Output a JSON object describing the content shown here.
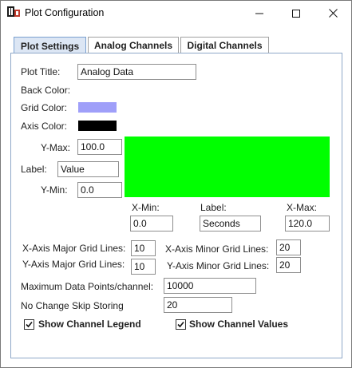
{
  "window": {
    "title": "Plot Configuration",
    "icons": {
      "app": "app-logo-icon",
      "minimize": "minimize-icon",
      "maximize": "maximize-icon",
      "close": "close-icon"
    }
  },
  "tabs": [
    {
      "label": "Plot Settings",
      "active": true
    },
    {
      "label": "Analog Channels",
      "active": false
    },
    {
      "label": "Digital Channels",
      "active": false
    }
  ],
  "plot_settings": {
    "plot_title_label": "Plot Title:",
    "plot_title_value": "Analog Data",
    "back_color_label": "Back Color:",
    "back_color": "#ffffff",
    "grid_color_label": "Grid Color:",
    "grid_color": "#9f9ff9",
    "axis_color_label": "Axis Color:",
    "axis_color": "#000000",
    "plot_preview_color": "#00ff00",
    "ymax_label": "Y-Max:",
    "ymax_value": "100.0",
    "ylabel_label": "Label:",
    "ylabel_value": "Value",
    "ymin_label": "Y-Min:",
    "ymin_value": "0.0",
    "xmin_label": "X-Min:",
    "xmin_value": "0.0",
    "xlabel_label": "Label:",
    "xlabel_value": "Seconds",
    "xmax_label": "X-Max:",
    "xmax_value": "120.0",
    "x_major_label": "X-Axis Major Grid Lines:",
    "x_major_value": "10",
    "x_minor_label": "X-Axis Minor Grid Lines:",
    "x_minor_value": "20",
    "y_major_label": "Y-Axis Major Grid Lines:",
    "y_major_value": "10",
    "y_minor_label": "Y-Axis Minor Grid Lines:",
    "y_minor_value": "20",
    "max_points_label": "Maximum Data Points/channel:",
    "max_points_value": "10000",
    "no_change_label": "No Change Skip Storing",
    "no_change_value": "20",
    "show_legend_label": "Show Channel Legend",
    "show_legend_checked": true,
    "show_values_label": "Show Channel Values",
    "show_values_checked": true
  }
}
